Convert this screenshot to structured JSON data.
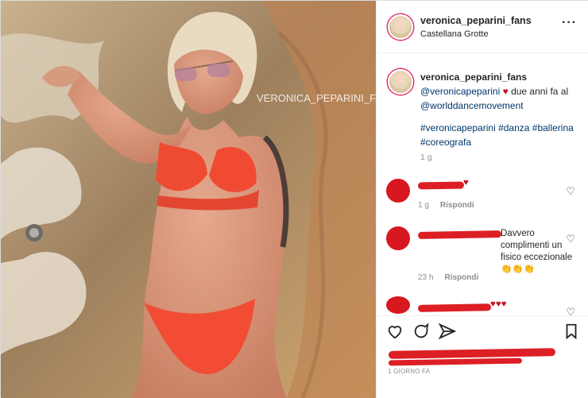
{
  "post": {
    "username": "veronica_peparini_fans",
    "location": "Castellana Grotte",
    "watermark": "VERONICA_PEPARINI_FANS",
    "caption_user": "veronica_peparini_fans",
    "caption_line1_mention": "@veronicapeparini",
    "caption_line1_rest": "due anni fa al",
    "caption_line2": "@worlddancemovement",
    "caption_tags": "#veronicapeparini #danza #ballerina #coreografa",
    "caption_time": "1 g",
    "date": "1 GIORNO FA",
    "more_icon": "more-horizontal-icon"
  },
  "comments": [
    {
      "name": "redacted",
      "text": "",
      "time": "1 g",
      "reply": "Rispondi"
    },
    {
      "name": "redacted",
      "text": "Davvero complimenti un fisico eccezionale 👏👏👏",
      "time": "23 h",
      "reply": "Rispondi"
    },
    {
      "name": "redacted",
      "text": "",
      "time": "",
      "reply": ""
    }
  ],
  "actions": {
    "like_icon": "heart-icon",
    "comment_icon": "comment-icon",
    "share_icon": "paper-plane-icon",
    "save_icon": "bookmark-icon"
  },
  "colors": {
    "redaction": "#dc1f25",
    "mention": "#00376b",
    "muted": "#8e8e8e"
  }
}
